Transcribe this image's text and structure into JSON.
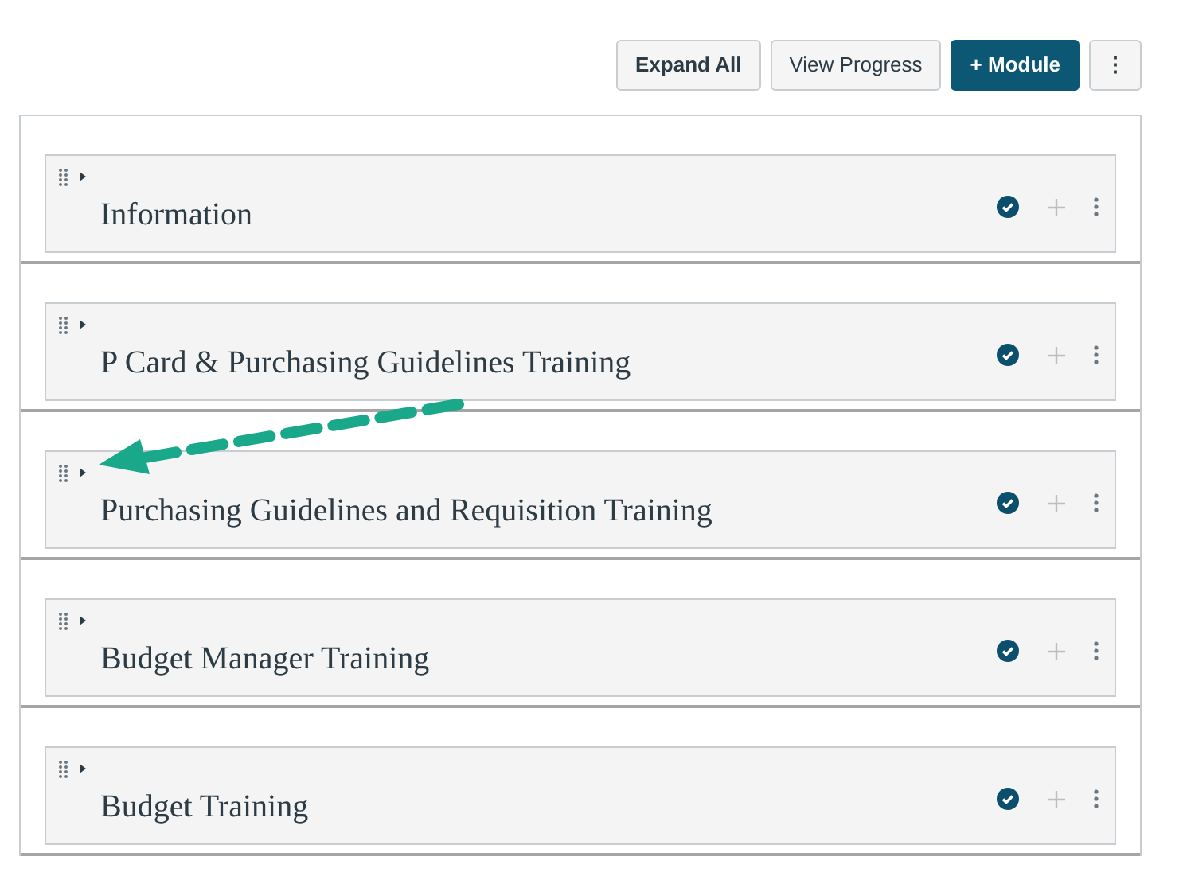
{
  "toolbar": {
    "buttons": [
      {
        "label": "Expand All",
        "kind": "bold"
      },
      {
        "label": "View Progress",
        "kind": "plain"
      },
      {
        "label": "Module",
        "kind": "primary",
        "icon": "+"
      },
      {
        "label": "⋮",
        "kind": "more"
      }
    ]
  },
  "modules": [
    {
      "title": "Information",
      "published": true,
      "expanded": false
    },
    {
      "title": "P Card & Purchasing Guidelines Training",
      "published": true,
      "expanded": false
    },
    {
      "title": "Purchasing Guidelines and Requisition Training",
      "published": true,
      "expanded": false
    },
    {
      "title": "Budget Manager Training",
      "published": true,
      "expanded": false
    },
    {
      "title": "Budget Training",
      "published": true,
      "expanded": false
    }
  ]
}
